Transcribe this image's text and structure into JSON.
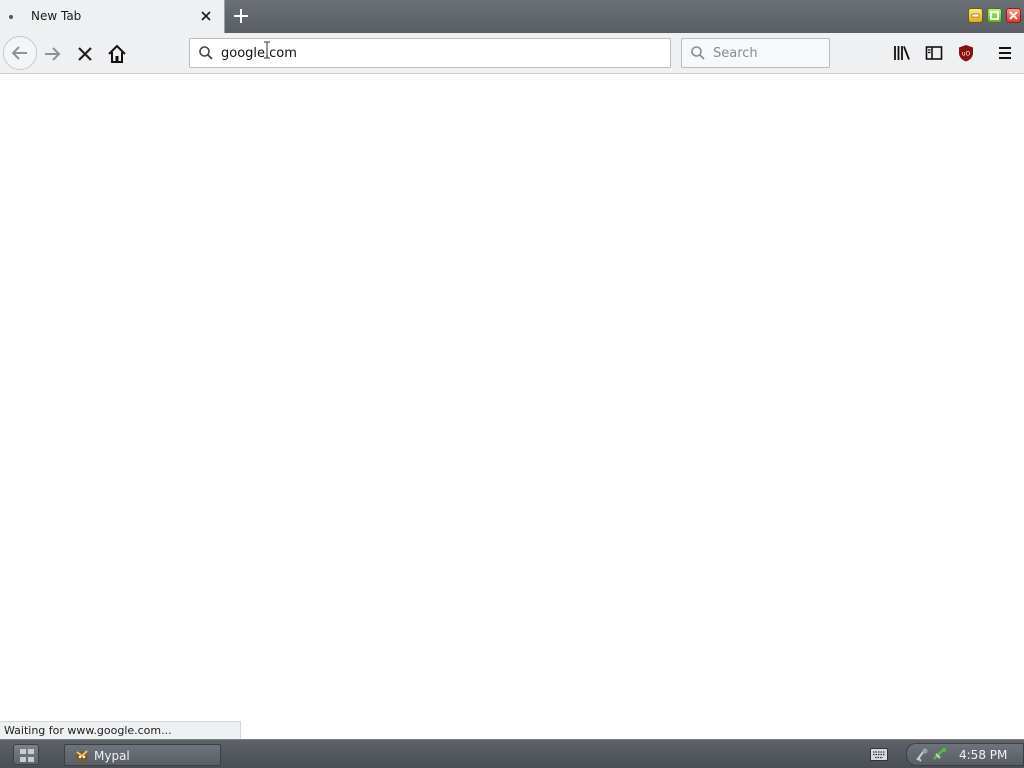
{
  "tab": {
    "title": "New Tab"
  },
  "urlbar": {
    "value": "google.com"
  },
  "searchbar": {
    "placeholder": "Search"
  },
  "status": {
    "text": "Waiting for www.google.com..."
  },
  "taskbar": {
    "app_label": "Mypal",
    "clock": "4:58 PM"
  },
  "icons": {
    "back": "back-arrow-icon",
    "forward": "forward-arrow-icon",
    "stop": "stop-icon",
    "home": "home-icon",
    "library": "library-icon",
    "sidebar": "sidebar-icon",
    "ublock": "ublock-origin-icon",
    "menu": "hamburger-menu-icon"
  },
  "colors": {
    "ublock": "#8b0f0f",
    "window_close": "#d9362b",
    "window_minimize": "#e0a91e",
    "window_maximize": "#5fae27"
  }
}
